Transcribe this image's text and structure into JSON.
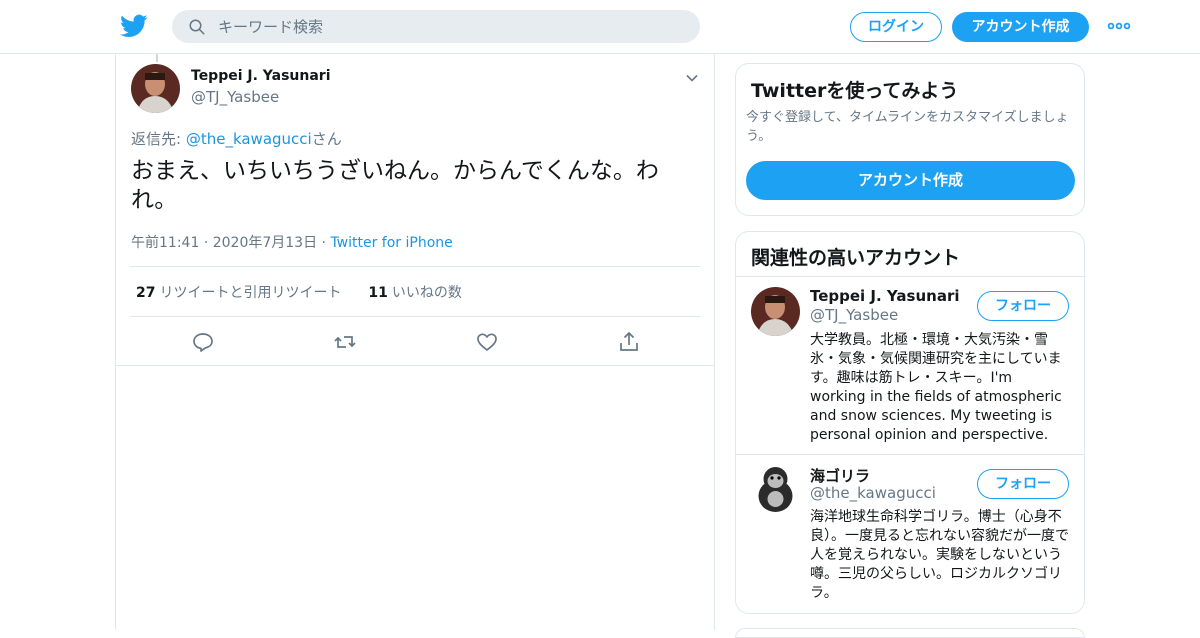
{
  "header": {
    "logo_icon": "twitter-bird-icon",
    "search_placeholder": "キーワード検索",
    "login_label": "ログイン",
    "signup_label": "アカウント作成",
    "more_icon": "more-dots-icon",
    "brand_color": "#1da1f2"
  },
  "tweet": {
    "author_name": "Teppei J. Yasunari",
    "author_handle": "@TJ_Yasbee",
    "reply_prefix": "返信先: ",
    "reply_handle": "@the_kawagucci",
    "reply_suffix": "さん",
    "text": "おまえ、いちいちうざいねん。からんでくんな。われ。",
    "time": "午前11:41",
    "date": "2020年7月13日",
    "source": "Twitter for iPhone",
    "retweets_count": "27",
    "retweets_label": "リツイートと引用リツイート",
    "likes_count": "11",
    "likes_label": "いいねの数"
  },
  "sidebar": {
    "signup_card": {
      "title": "Twitterを使ってみよう",
      "description": "今すぐ登録して、タイムラインをカスタマイズしましょう。",
      "button_label": "アカウント作成"
    },
    "related": {
      "title": "関連性の高いアカウント",
      "accounts": [
        {
          "name": "Teppei J. Yasunari",
          "handle": "@TJ_Yasbee",
          "follow_label": "フォロー",
          "bio": "大学教員。北極・環境・大気汚染・雪氷・気象・気候関連研究を主にしています。趣味は筋トレ・スキー。I'm working in the fields of atmospheric and snow sciences. My tweeting is personal opinion and perspective."
        },
        {
          "name": "海ゴリラ",
          "handle": "@the_kawagucci",
          "follow_label": "フォロー",
          "bio": "海洋地球生命科学ゴリラ。博士（心身不良）。一度見ると忘れない容貌だが一度で人を覚えられない。実験をしないという噂。三児の父らしい。ロジカルクソゴリラ。"
        }
      ]
    }
  }
}
